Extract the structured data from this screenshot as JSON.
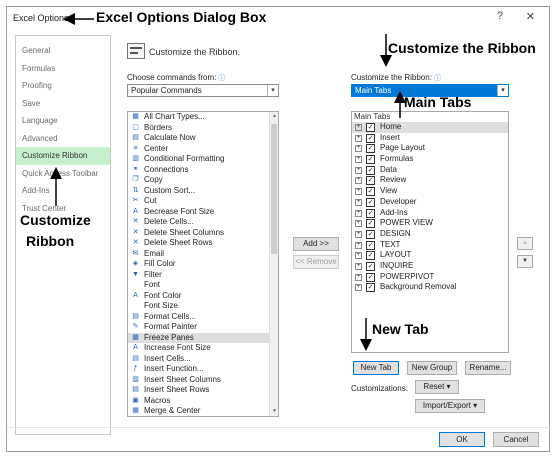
{
  "dialog": {
    "title": "Excel Options",
    "help_icon": "?",
    "close_icon": "✕"
  },
  "annotations": {
    "dialog_box": "Excel Options Dialog Box",
    "customize_the_ribbon": "Customize the Ribbon",
    "main_tabs": "Main Tabs",
    "customize_ribbon_line1": "Customize",
    "customize_ribbon_line2": "Ribbon",
    "new_tab": "New Tab"
  },
  "sidebar": {
    "items": [
      {
        "label": "General"
      },
      {
        "label": "Formulas"
      },
      {
        "label": "Proofing"
      },
      {
        "label": "Save"
      },
      {
        "label": "Language"
      },
      {
        "label": "Advanced"
      },
      {
        "label": "Customize Ribbon",
        "active": true
      },
      {
        "label": "Quick Access Toolbar"
      },
      {
        "label": "Add-Ins"
      },
      {
        "label": "Trust Center"
      }
    ]
  },
  "header": {
    "title": "Customize the Ribbon.",
    "icon": "ribbon-icon"
  },
  "left_panel": {
    "label": "Choose commands from:",
    "info_icon": "ⓘ",
    "dropdown_value": "Popular Commands",
    "commands": [
      {
        "label": "All Chart Types...",
        "icon": "▦"
      },
      {
        "label": "Borders",
        "icon": "▢",
        "submenu": true
      },
      {
        "label": "Calculate Now",
        "icon": "▤"
      },
      {
        "label": "Center",
        "icon": "≡"
      },
      {
        "label": "Conditional Formatting",
        "icon": "▥",
        "submenu": true
      },
      {
        "label": "Connections",
        "icon": "⚭"
      },
      {
        "label": "Copy",
        "icon": "❐"
      },
      {
        "label": "Custom Sort...",
        "icon": "⇅"
      },
      {
        "label": "Cut",
        "icon": "✂"
      },
      {
        "label": "Decrease Font Size",
        "icon": "A"
      },
      {
        "label": "Delete Cells...",
        "icon": "✕"
      },
      {
        "label": "Delete Sheet Columns",
        "icon": "✕"
      },
      {
        "label": "Delete Sheet Rows",
        "icon": "✕"
      },
      {
        "label": "Email",
        "icon": "✉"
      },
      {
        "label": "Fill Color",
        "icon": "◈",
        "submenu": true
      },
      {
        "label": "Filter",
        "icon": "▼"
      },
      {
        "label": "Font",
        "icon": "",
        "mark": true
      },
      {
        "label": "Font Color",
        "icon": "A",
        "submenu": true
      },
      {
        "label": "Font Size",
        "icon": "",
        "mark": true
      },
      {
        "label": "Format Cells...",
        "icon": "▤"
      },
      {
        "label": "Format Painter",
        "icon": "✎"
      },
      {
        "label": "Freeze Panes",
        "icon": "▦",
        "submenu": true,
        "selected": true
      },
      {
        "label": "Increase Font Size",
        "icon": "A"
      },
      {
        "label": "Insert Cells...",
        "icon": "▤"
      },
      {
        "label": "Insert Function...",
        "icon": "ƒ"
      },
      {
        "label": "Insert Sheet Columns",
        "icon": "▥"
      },
      {
        "label": "Insert Sheet Rows",
        "icon": "▤"
      },
      {
        "label": "Macros",
        "icon": "▣"
      },
      {
        "label": "Merge & Center",
        "icon": "▦"
      }
    ]
  },
  "middle": {
    "add_label": "Add >>",
    "remove_label": "<< Remove"
  },
  "right_panel": {
    "label": "Customize the Ribbon:",
    "info_icon": "ⓘ",
    "dropdown_value": "Main Tabs",
    "tree_header": "Main Tabs",
    "tabs": [
      {
        "label": "Home",
        "checked": true,
        "selected": true
      },
      {
        "label": "Insert",
        "checked": true
      },
      {
        "label": "Page Layout",
        "checked": true
      },
      {
        "label": "Formulas",
        "checked": true
      },
      {
        "label": "Data",
        "checked": true
      },
      {
        "label": "Review",
        "checked": true
      },
      {
        "label": "View",
        "checked": true
      },
      {
        "label": "Developer",
        "checked": true
      },
      {
        "label": "Add-Ins",
        "checked": true
      },
      {
        "label": "POWER VIEW",
        "checked": true
      },
      {
        "label": "DESIGN",
        "checked": true
      },
      {
        "label": "TEXT",
        "checked": true
      },
      {
        "label": "LAYOUT",
        "checked": true
      },
      {
        "label": "INQUIRE",
        "checked": true
      },
      {
        "label": "POWERPIVOT",
        "checked": true
      },
      {
        "label": "Background Removal",
        "checked": true
      }
    ],
    "new_tab_label": "New Tab",
    "new_group_label": "New Group",
    "rename_label": "Rename...",
    "customizations_label": "Customizations:",
    "reset_label": "Reset ▾",
    "import_export_label": "Import/Export ▾",
    "move_up_icon": "▲",
    "move_down_icon": "▼"
  },
  "footer": {
    "ok_label": "OK",
    "cancel_label": "Cancel"
  }
}
